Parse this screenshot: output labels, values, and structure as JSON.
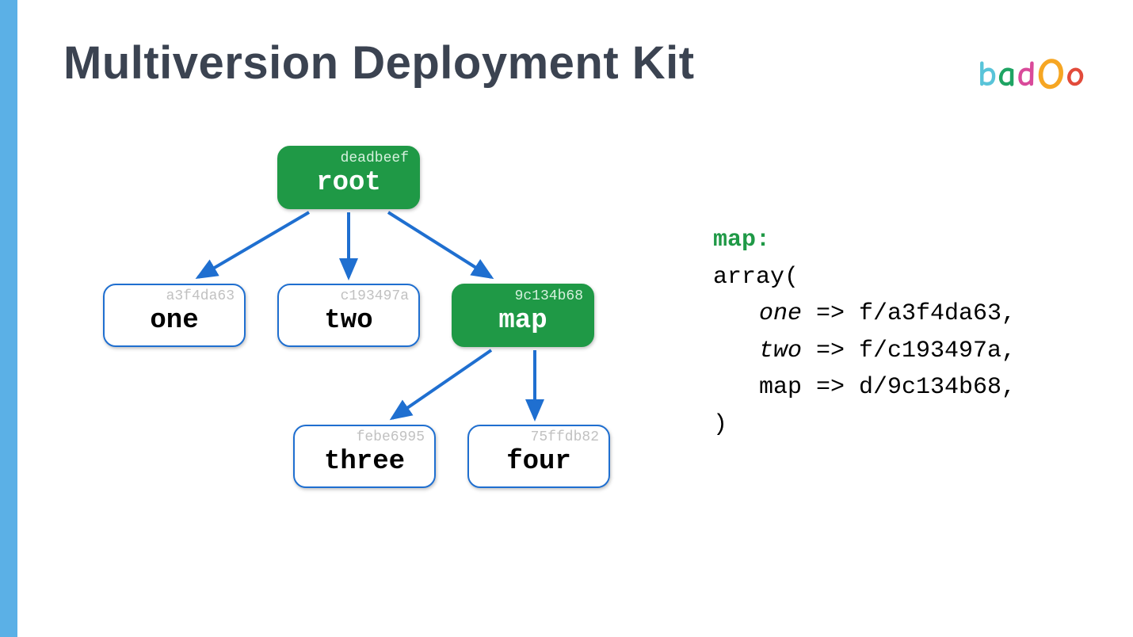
{
  "title": "Multiversion Deployment Kit",
  "logo": {
    "b": "b",
    "a": "a",
    "d": "d",
    "o1": "O",
    "o2": "o"
  },
  "nodes": {
    "root": {
      "hash": "deadbeef",
      "label": "root"
    },
    "one": {
      "hash": "a3f4da63",
      "label": "one"
    },
    "two": {
      "hash": "c193497a",
      "label": "two"
    },
    "map": {
      "hash": "9c134b68",
      "label": "map"
    },
    "three": {
      "hash": "febe6995",
      "label": "three"
    },
    "four": {
      "hash": "75ffdb82",
      "label": "four"
    }
  },
  "code": {
    "header": "map:",
    "open": "array(",
    "line1_key": "one",
    "line1_val": " => f/a3f4da63,",
    "line2_key": "two",
    "line2_val": " => f/c193497a,",
    "line3_key": "map",
    "line3_val": " => d/9c134b68,",
    "close": ")"
  },
  "colors": {
    "accent_bar": "#5bb0e6",
    "node_border": "#1f6fd0",
    "node_green": "#1f9946",
    "arrow": "#1f6fd0"
  }
}
